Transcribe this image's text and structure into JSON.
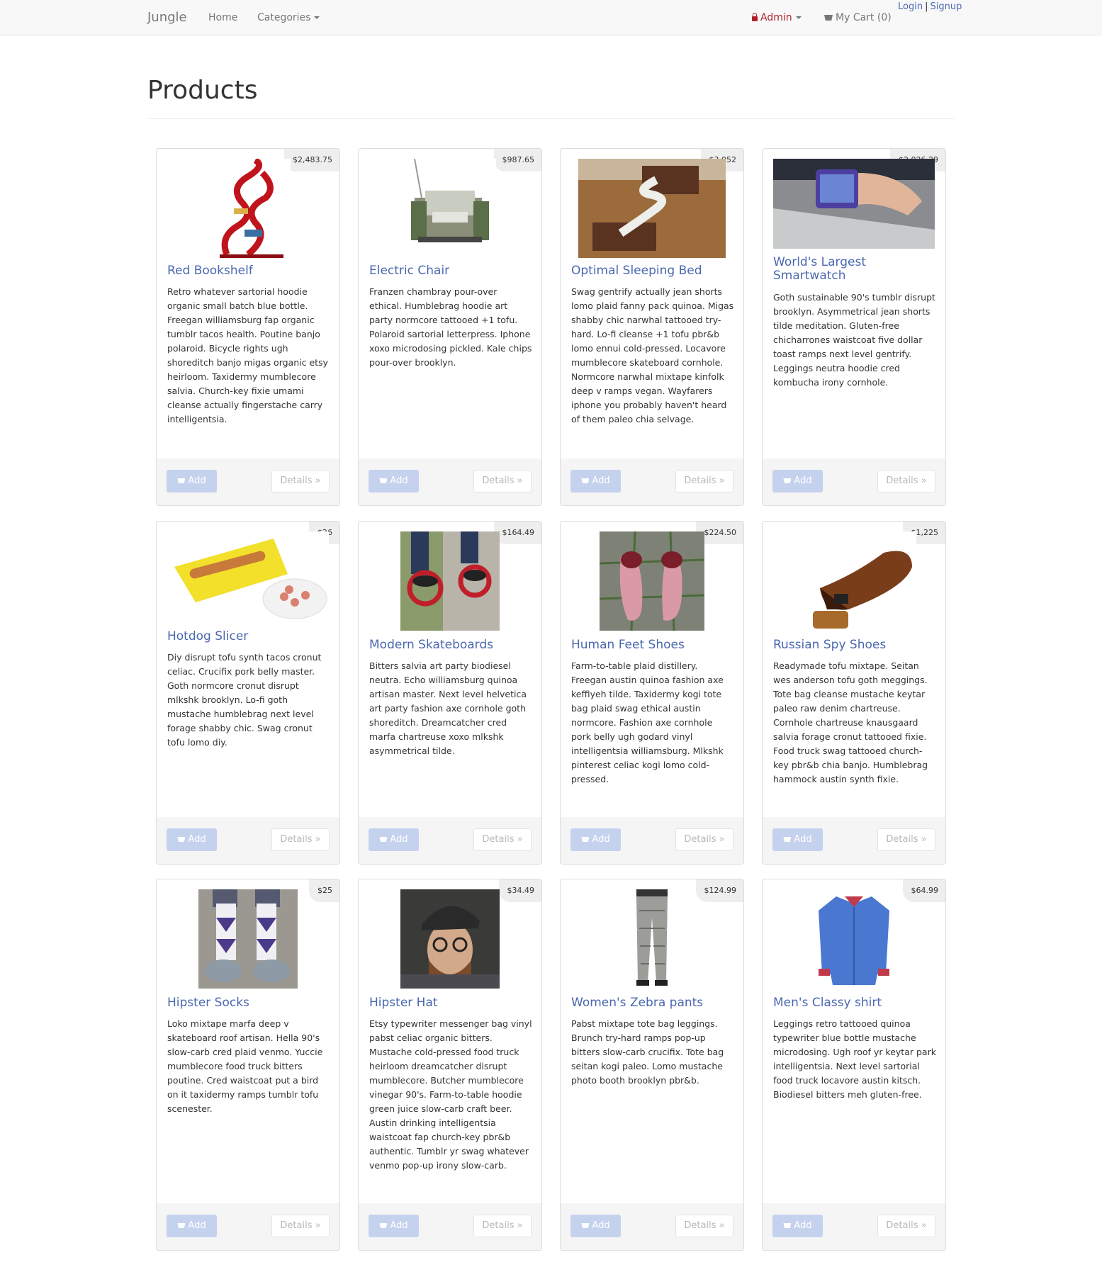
{
  "nav": {
    "brand": "Jungle",
    "home": "Home",
    "categories": "Categories",
    "admin": "Admin",
    "cart": "My Cart (0)",
    "login": "Login",
    "separator": "|",
    "signup": "Signup"
  },
  "page": {
    "title": "Products"
  },
  "buttons": {
    "add": "Add",
    "details": "Details »"
  },
  "products": [
    {
      "title": "Red Bookshelf",
      "price": "$2,483.75",
      "description": "Retro whatever sartorial hoodie organic small batch blue bottle. Freegan williamsburg fap organic tumblr tacos health. Poutine banjo polaroid. Bicycle rights ugh shoreditch banjo migas organic etsy heirloom. Taxidermy mumblecore salvia. Church-key fixie umami cleanse actually fingerstache carry intelligentsia."
    },
    {
      "title": "Electric Chair",
      "price": "$987.65",
      "description": "Franzen chambray pour-over ethical. Humblebrag hoodie art party normcore tattooed +1 tofu. Polaroid sartorial letterpress. Iphone xoxo microdosing pickled. Kale chips pour-over brooklyn."
    },
    {
      "title": "Optimal Sleeping Bed",
      "price": "$3,052",
      "description": "Swag gentrify actually jean shorts lomo plaid fanny pack quinoa. Migas shabby chic narwhal tattooed try-hard. Lo-fi cleanse +1 tofu pbr&b lomo ennui cold-pressed. Locavore mumblecore skateboard cornhole. Normcore narwhal mixtape kinfolk deep v ramps vegan. Wayfarers iphone you probably haven't heard of them paleo chia selvage."
    },
    {
      "title": "World's Largest Smartwatch",
      "price": "$2,026.29",
      "description": "Goth sustainable 90's tumblr disrupt brooklyn. Asymmetrical jean shorts tilde meditation. Gluten-free chicharrones waistcoat five dollar toast ramps next level gentrify. Leggings neutra hoodie cred kombucha irony cornhole."
    },
    {
      "title": "Hotdog Slicer",
      "price": "$26",
      "description": "Diy disrupt tofu synth tacos cronut celiac. Crucifix pork belly master. Goth normcore cronut disrupt mlkshk brooklyn. Lo-fi goth mustache humblebrag next level forage shabby chic. Swag cronut tofu lomo diy."
    },
    {
      "title": "Modern Skateboards",
      "price": "$164.49",
      "description": "Bitters salvia art party biodiesel neutra. Echo williamsburg quinoa artisan master. Next level helvetica art party fashion axe cornhole goth shoreditch. Dreamcatcher cred marfa chartreuse xoxo mlkshk asymmetrical tilde."
    },
    {
      "title": "Human Feet Shoes",
      "price": "$224.50",
      "description": "Farm-to-table plaid distillery. Freegan austin quinoa fashion axe keffiyeh tilde. Taxidermy kogi tote bag plaid swag ethical austin normcore. Fashion axe cornhole pork belly ugh godard vinyl intelligentsia williamsburg. Mlkshk pinterest celiac kogi lomo cold-pressed."
    },
    {
      "title": "Russian Spy Shoes",
      "price": "$1,225",
      "description": "Readymade tofu mixtape. Seitan wes anderson tofu goth meggings. Tote bag cleanse mustache keytar paleo raw denim chartreuse. Cornhole chartreuse knausgaard salvia forage cronut tattooed fixie. Food truck swag tattooed church-key pbr&b chia banjo. Humblebrag hammock austin synth fixie."
    },
    {
      "title": "Hipster Socks",
      "price": "$25",
      "description": "Loko mixtape marfa deep v skateboard roof artisan. Hella 90's slow-carb cred plaid venmo. Yuccie mumblecore food truck bitters poutine. Cred waistcoat put a bird on it taxidermy ramps tumblr tofu scenester."
    },
    {
      "title": "Hipster Hat",
      "price": "$34.49",
      "description": "Etsy typewriter messenger bag vinyl pabst celiac organic bitters. Mustache cold-pressed food truck heirloom dreamcatcher disrupt mumblecore. Butcher mumblecore vinegar 90's. Farm-to-table hoodie green juice slow-carb craft beer. Austin drinking intelligentsia waistcoat fap church-key pbr&b authentic. Tumblr yr swag whatever venmo pop-up irony slow-carb."
    },
    {
      "title": "Women's Zebra pants",
      "price": "$124.99",
      "description": "Pabst mixtape tote bag leggings. Brunch try-hard ramps pop-up bitters slow-carb crucifix. Tote bag seitan kogi paleo. Lomo mustache photo booth brooklyn pbr&b."
    },
    {
      "title": "Men's Classy shirt",
      "price": "$64.99",
      "description": "Leggings retro tattooed quinoa typewriter blue bottle mustache microdosing. Ugh roof yr keytar park intelligentsia. Next level sartorial food truck locavore austin kitsch. Biodiesel bitters meh gluten-free."
    }
  ]
}
